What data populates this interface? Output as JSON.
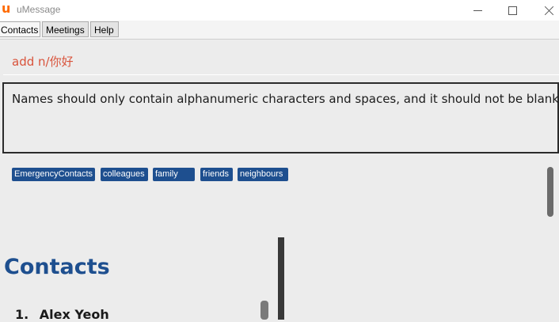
{
  "window": {
    "logo_letter": "u",
    "title": "uMessage",
    "controls": [
      "minimize-icon",
      "maximize-icon",
      "close-icon"
    ]
  },
  "menu": {
    "items": [
      {
        "label": "Contacts"
      },
      {
        "label": "Meetings"
      },
      {
        "label": "Help"
      }
    ]
  },
  "command_box": {
    "value": "add n/你好"
  },
  "result_display": {
    "message": "Names should only contain alphanumeric characters and spaces, and it should not be blank"
  },
  "tags": [
    "EmergencyContacts",
    "colleagues",
    "family",
    "friends",
    "neighbours"
  ],
  "contacts_pane": {
    "title": "Contacts",
    "contacts": [
      {
        "index": "1.",
        "name": "Alex Yeoh"
      }
    ]
  },
  "colors": {
    "accent": "#1e4f8f",
    "command_text": "#d9533b",
    "logo": "#ff6a00"
  }
}
